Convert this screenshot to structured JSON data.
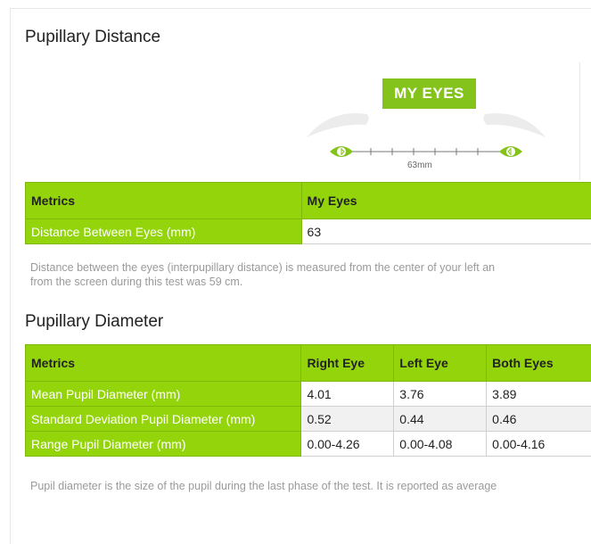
{
  "pupillary_distance": {
    "title": "Pupillary Distance",
    "badge": "MY EYES",
    "measure_label": "63mm",
    "table": {
      "headers": [
        "Metrics",
        "My Eyes"
      ],
      "rows": [
        [
          "Distance Between Eyes (mm)",
          "63"
        ]
      ]
    },
    "note_line1": "Distance between the eyes (interpupillary distance) is measured from the center of your left an",
    "note_line2": "from the screen during this test was 59 cm."
  },
  "pupillary_diameter": {
    "title": "Pupillary Diameter",
    "table": {
      "headers": [
        "Metrics",
        "Right Eye",
        "Left Eye",
        "Both Eyes"
      ],
      "rows": [
        [
          "Mean Pupil Diameter (mm)",
          "4.01",
          "3.76",
          "3.89"
        ],
        [
          "Standard Deviation Pupil Diameter (mm)",
          "0.52",
          "0.44",
          "0.46"
        ],
        [
          "Range Pupil Diameter (mm)",
          "0.00-4.26",
          "0.00-4.08",
          "0.00-4.16"
        ]
      ]
    },
    "note": "Pupil diameter is the size of the pupil during the last phase of the test. It is reported as average"
  },
  "colors": {
    "accent": "#94d40b",
    "badge": "#84c31b",
    "note_text": "#9a9a9a"
  },
  "icons": [
    "eyebrow-icon",
    "eye-icon"
  ]
}
